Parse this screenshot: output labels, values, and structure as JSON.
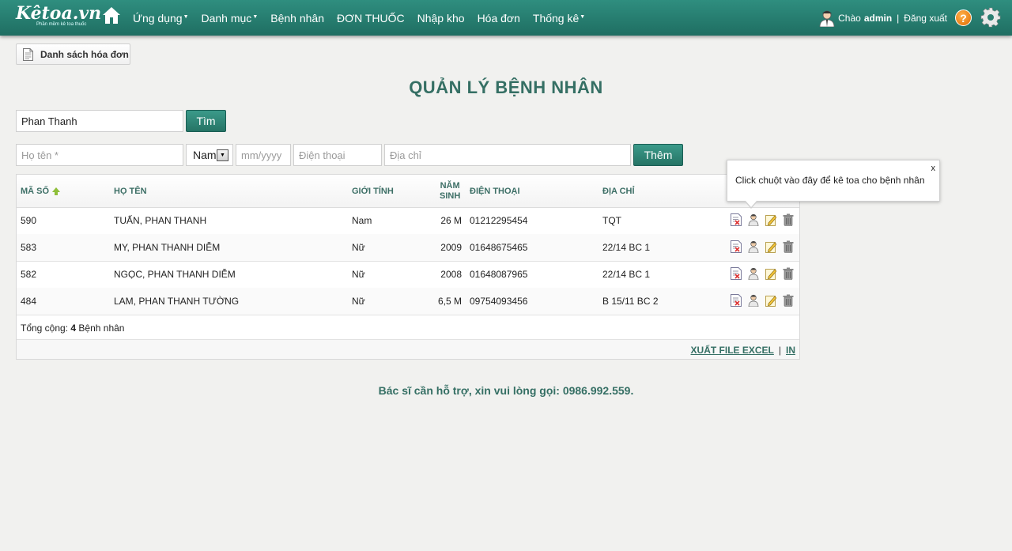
{
  "header": {
    "logo_text": "Kêtoa.vn",
    "logo_tagline": "Phần mềm kê toa thuốc",
    "nav": [
      {
        "label": "Ứng dụng",
        "dropdown": true
      },
      {
        "label": "Danh mục",
        "dropdown": true
      },
      {
        "label": "Bệnh nhân",
        "dropdown": false
      },
      {
        "label": "ĐƠN THUỐC",
        "dropdown": false
      },
      {
        "label": "Nhập kho",
        "dropdown": false
      },
      {
        "label": "Hóa đơn",
        "dropdown": false
      },
      {
        "label": "Thống kê",
        "dropdown": true
      }
    ],
    "greeting": "Chào",
    "username": "admin",
    "separator": "|",
    "logout": "Đăng xuất",
    "help_glyph": "?"
  },
  "invoice_button": {
    "label": "Danh sách hóa đơn"
  },
  "page_title": "QUẢN LÝ BỆNH NHÂN",
  "search": {
    "value": "Phan Thanh",
    "button": "Tìm"
  },
  "add_form": {
    "name_placeholder": "Họ tên *",
    "gender_value": "Nam",
    "dob_placeholder": "mm/yyyy",
    "phone_placeholder": "Điện thoại",
    "address_placeholder": "Địa chỉ",
    "button": "Thêm"
  },
  "table": {
    "headers": {
      "id": "MÃ SỐ",
      "name": "HỌ TÊN",
      "gender": "GIỚI TÍNH",
      "birth_line1": "NĂM",
      "birth_line2": "SINH",
      "phone": "ĐIỆN THOẠI",
      "address": "ĐỊA CHỈ"
    },
    "rows": [
      {
        "id": "590",
        "name": "TUẤN, PHAN THANH",
        "gender": "Nam",
        "birth": "26 M",
        "phone": "01212295454",
        "address": "TQT"
      },
      {
        "id": "583",
        "name": "MY, PHAN THANH DIỄM",
        "gender": "Nữ",
        "birth": "2009",
        "phone": "01648675465",
        "address": "22/14 BC 1"
      },
      {
        "id": "582",
        "name": "NGỌC, PHAN THANH DIỄM",
        "gender": "Nữ",
        "birth": "2008",
        "phone": "01648087965",
        "address": "22/14 BC 1"
      },
      {
        "id": "484",
        "name": "LAM, PHAN THANH TƯỜNG",
        "gender": "Nữ",
        "birth": "6,5 M",
        "phone": "09754093456",
        "address": "B 15/11 BC 2"
      }
    ],
    "total_label": "Tổng cộng:",
    "total_count": "4",
    "total_unit": "Bệnh nhân",
    "export_excel": "XUẤT FILE EXCEL",
    "link_separator": "|",
    "print": "IN"
  },
  "tooltip": {
    "text": "Click chuột vào đây để kê toa cho bệnh nhân",
    "close": "x"
  },
  "support_text": "Bác sĩ cần hỗ trợ, xin vui lòng gọi: 0986.992.559."
}
